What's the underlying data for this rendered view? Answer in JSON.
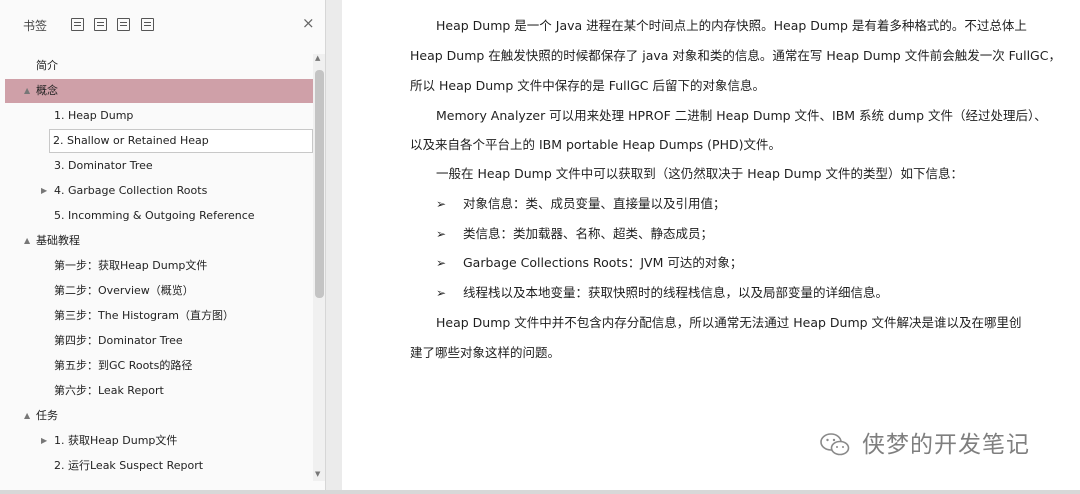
{
  "sidebar": {
    "title": "书签",
    "toolbar_icons": [
      "expand-all-icon",
      "collapse-all-icon",
      "add-bookmark-icon",
      "bookmark-options-icon"
    ],
    "close_label": "×",
    "items": [
      {
        "label": "简介",
        "level": 0,
        "arrow": ""
      },
      {
        "label": "概念",
        "level": 0,
        "arrow": "▲",
        "selected": true
      },
      {
        "label": "1. Heap Dump",
        "level": 1,
        "arrow": ""
      },
      {
        "label": "2. Shallow or Retained Heap",
        "level": 1,
        "arrow": "",
        "hover": true
      },
      {
        "label": "3. Dominator Tree",
        "level": 1,
        "arrow": ""
      },
      {
        "label": "4. Garbage Collection Roots",
        "level": 1,
        "arrow": "▶"
      },
      {
        "label": "5. Incomming & Outgoing Reference",
        "level": 1,
        "arrow": ""
      },
      {
        "label": "基础教程",
        "level": 0,
        "arrow": "▲"
      },
      {
        "label": "第一步：获取Heap Dump文件",
        "level": 1,
        "arrow": ""
      },
      {
        "label": "第二步：Overview（概览）",
        "level": 1,
        "arrow": ""
      },
      {
        "label": "第三步：The Histogram（直方图）",
        "level": 1,
        "arrow": ""
      },
      {
        "label": "第四步：Dominator Tree",
        "level": 1,
        "arrow": ""
      },
      {
        "label": "第五步：到GC Roots的路径",
        "level": 1,
        "arrow": ""
      },
      {
        "label": "第六步：Leak Report",
        "level": 1,
        "arrow": ""
      },
      {
        "label": "任务",
        "level": 0,
        "arrow": "▲"
      },
      {
        "label": "1. 获取Heap Dump文件",
        "level": 1,
        "arrow": "▶"
      },
      {
        "label": "2. 运行Leak Suspect Report",
        "level": 1,
        "arrow": ""
      }
    ]
  },
  "document": {
    "lines": [
      "Heap Dump 是一个 Java 进程在某个时间点上的内存快照。Heap Dump 是有着多种格式的。不过总体上",
      "Heap Dump 在触发快照的时候都保存了 java 对象和类的信息。通常在写 Heap Dump 文件前会触发一次 FullGC，",
      "所以 Heap Dump 文件中保存的是 FullGC 后留下的对象信息。",
      "Memory Analyzer 可以用来处理 HPROF 二进制 Heap Dump 文件、IBM 系统 dump 文件（经过处理后）、",
      "以及来自各个平台上的 IBM portable Heap Dumps (PHD)文件。",
      "一般在 Heap Dump 文件中可以获取到（这仍然取决于 Heap Dump 文件的类型）如下信息：",
      "对象信息：类、成员变量、直接量以及引用值；",
      "类信息：类加载器、名称、超类、静态成员；",
      "Garbage Collections Roots：JVM 可达的对象；",
      "线程栈以及本地变量：获取快照时的线程栈信息，以及局部变量的详细信息。",
      "Heap Dump 文件中并不包含内存分配信息，所以通常无法通过 Heap Dump 文件解决是谁以及在哪里创",
      "建了哪些对象这样的问题。"
    ],
    "bullet_glyph": "➢",
    "watermark": "侠梦的开发笔记"
  },
  "colors": {
    "selected_row": "#cfa0a8",
    "sidebar_bg": "#fafafa",
    "watermark": "#7f7f7f"
  }
}
